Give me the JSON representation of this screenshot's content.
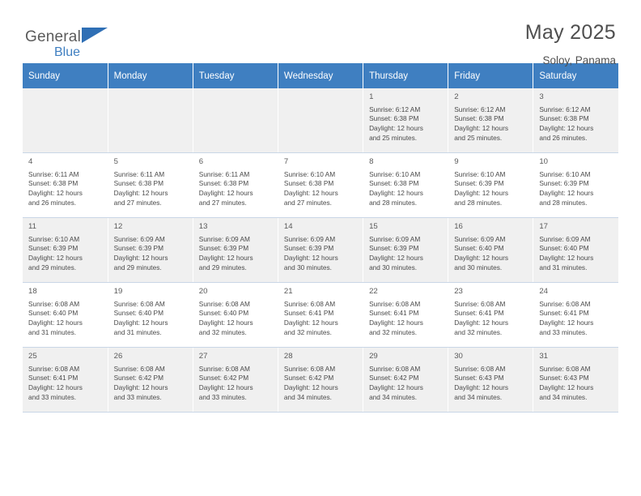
{
  "brand": {
    "name_top": "General",
    "name_bottom": "Blue",
    "flag_icon": "blue-flag-icon",
    "accent": "#3f7fc1"
  },
  "header": {
    "title": "May 2025",
    "location": "Soloy, Panama"
  },
  "calendar": {
    "weekday_headers": [
      "Sunday",
      "Monday",
      "Tuesday",
      "Wednesday",
      "Thursday",
      "Friday",
      "Saturday"
    ],
    "weeks": [
      [
        {
          "day": "",
          "lines": []
        },
        {
          "day": "",
          "lines": []
        },
        {
          "day": "",
          "lines": []
        },
        {
          "day": "",
          "lines": []
        },
        {
          "day": "1",
          "lines": [
            "Sunrise: 6:12 AM",
            "Sunset: 6:38 PM",
            "Daylight: 12 hours",
            "and 25 minutes."
          ]
        },
        {
          "day": "2",
          "lines": [
            "Sunrise: 6:12 AM",
            "Sunset: 6:38 PM",
            "Daylight: 12 hours",
            "and 25 minutes."
          ]
        },
        {
          "day": "3",
          "lines": [
            "Sunrise: 6:12 AM",
            "Sunset: 6:38 PM",
            "Daylight: 12 hours",
            "and 26 minutes."
          ]
        }
      ],
      [
        {
          "day": "4",
          "lines": [
            "Sunrise: 6:11 AM",
            "Sunset: 6:38 PM",
            "Daylight: 12 hours",
            "and 26 minutes."
          ]
        },
        {
          "day": "5",
          "lines": [
            "Sunrise: 6:11 AM",
            "Sunset: 6:38 PM",
            "Daylight: 12 hours",
            "and 27 minutes."
          ]
        },
        {
          "day": "6",
          "lines": [
            "Sunrise: 6:11 AM",
            "Sunset: 6:38 PM",
            "Daylight: 12 hours",
            "and 27 minutes."
          ]
        },
        {
          "day": "7",
          "lines": [
            "Sunrise: 6:10 AM",
            "Sunset: 6:38 PM",
            "Daylight: 12 hours",
            "and 27 minutes."
          ]
        },
        {
          "day": "8",
          "lines": [
            "Sunrise: 6:10 AM",
            "Sunset: 6:38 PM",
            "Daylight: 12 hours",
            "and 28 minutes."
          ]
        },
        {
          "day": "9",
          "lines": [
            "Sunrise: 6:10 AM",
            "Sunset: 6:39 PM",
            "Daylight: 12 hours",
            "and 28 minutes."
          ]
        },
        {
          "day": "10",
          "lines": [
            "Sunrise: 6:10 AM",
            "Sunset: 6:39 PM",
            "Daylight: 12 hours",
            "and 28 minutes."
          ]
        }
      ],
      [
        {
          "day": "11",
          "lines": [
            "Sunrise: 6:10 AM",
            "Sunset: 6:39 PM",
            "Daylight: 12 hours",
            "and 29 minutes."
          ]
        },
        {
          "day": "12",
          "lines": [
            "Sunrise: 6:09 AM",
            "Sunset: 6:39 PM",
            "Daylight: 12 hours",
            "and 29 minutes."
          ]
        },
        {
          "day": "13",
          "lines": [
            "Sunrise: 6:09 AM",
            "Sunset: 6:39 PM",
            "Daylight: 12 hours",
            "and 29 minutes."
          ]
        },
        {
          "day": "14",
          "lines": [
            "Sunrise: 6:09 AM",
            "Sunset: 6:39 PM",
            "Daylight: 12 hours",
            "and 30 minutes."
          ]
        },
        {
          "day": "15",
          "lines": [
            "Sunrise: 6:09 AM",
            "Sunset: 6:39 PM",
            "Daylight: 12 hours",
            "and 30 minutes."
          ]
        },
        {
          "day": "16",
          "lines": [
            "Sunrise: 6:09 AM",
            "Sunset: 6:40 PM",
            "Daylight: 12 hours",
            "and 30 minutes."
          ]
        },
        {
          "day": "17",
          "lines": [
            "Sunrise: 6:09 AM",
            "Sunset: 6:40 PM",
            "Daylight: 12 hours",
            "and 31 minutes."
          ]
        }
      ],
      [
        {
          "day": "18",
          "lines": [
            "Sunrise: 6:08 AM",
            "Sunset: 6:40 PM",
            "Daylight: 12 hours",
            "and 31 minutes."
          ]
        },
        {
          "day": "19",
          "lines": [
            "Sunrise: 6:08 AM",
            "Sunset: 6:40 PM",
            "Daylight: 12 hours",
            "and 31 minutes."
          ]
        },
        {
          "day": "20",
          "lines": [
            "Sunrise: 6:08 AM",
            "Sunset: 6:40 PM",
            "Daylight: 12 hours",
            "and 32 minutes."
          ]
        },
        {
          "day": "21",
          "lines": [
            "Sunrise: 6:08 AM",
            "Sunset: 6:41 PM",
            "Daylight: 12 hours",
            "and 32 minutes."
          ]
        },
        {
          "day": "22",
          "lines": [
            "Sunrise: 6:08 AM",
            "Sunset: 6:41 PM",
            "Daylight: 12 hours",
            "and 32 minutes."
          ]
        },
        {
          "day": "23",
          "lines": [
            "Sunrise: 6:08 AM",
            "Sunset: 6:41 PM",
            "Daylight: 12 hours",
            "and 32 minutes."
          ]
        },
        {
          "day": "24",
          "lines": [
            "Sunrise: 6:08 AM",
            "Sunset: 6:41 PM",
            "Daylight: 12 hours",
            "and 33 minutes."
          ]
        }
      ],
      [
        {
          "day": "25",
          "lines": [
            "Sunrise: 6:08 AM",
            "Sunset: 6:41 PM",
            "Daylight: 12 hours",
            "and 33 minutes."
          ]
        },
        {
          "day": "26",
          "lines": [
            "Sunrise: 6:08 AM",
            "Sunset: 6:42 PM",
            "Daylight: 12 hours",
            "and 33 minutes."
          ]
        },
        {
          "day": "27",
          "lines": [
            "Sunrise: 6:08 AM",
            "Sunset: 6:42 PM",
            "Daylight: 12 hours",
            "and 33 minutes."
          ]
        },
        {
          "day": "28",
          "lines": [
            "Sunrise: 6:08 AM",
            "Sunset: 6:42 PM",
            "Daylight: 12 hours",
            "and 34 minutes."
          ]
        },
        {
          "day": "29",
          "lines": [
            "Sunrise: 6:08 AM",
            "Sunset: 6:42 PM",
            "Daylight: 12 hours",
            "and 34 minutes."
          ]
        },
        {
          "day": "30",
          "lines": [
            "Sunrise: 6:08 AM",
            "Sunset: 6:43 PM",
            "Daylight: 12 hours",
            "and 34 minutes."
          ]
        },
        {
          "day": "31",
          "lines": [
            "Sunrise: 6:08 AM",
            "Sunset: 6:43 PM",
            "Daylight: 12 hours",
            "and 34 minutes."
          ]
        }
      ]
    ]
  }
}
